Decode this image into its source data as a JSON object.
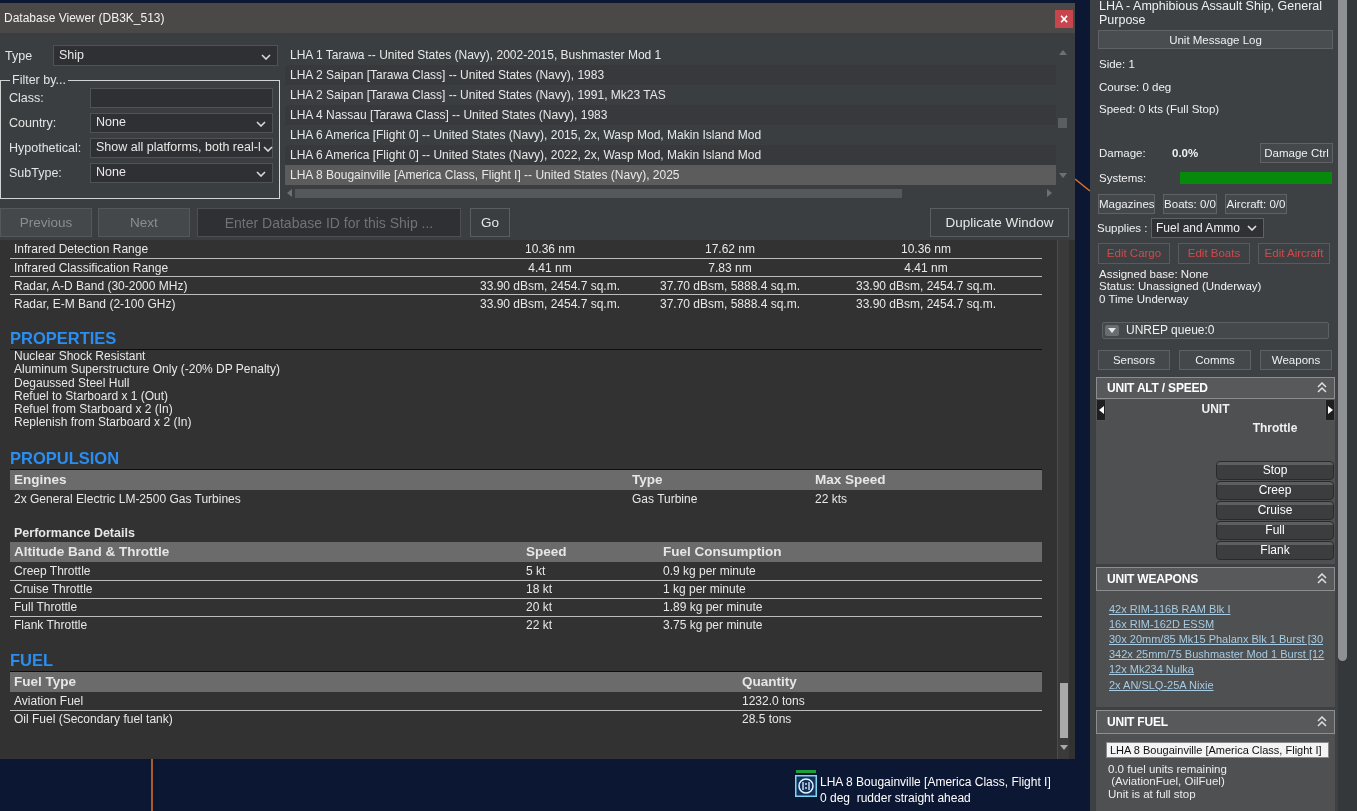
{
  "window": {
    "title": "Database Viewer (DB3K_513)",
    "close_label": "×"
  },
  "filters": {
    "type": {
      "label": "Type",
      "value": "Ship"
    },
    "legend": "Filter by...",
    "fields": [
      {
        "label": "Class:",
        "kind": "text"
      },
      {
        "label": "Country:",
        "kind": "select",
        "value": "None"
      },
      {
        "label": "Hypothetical:",
        "kind": "select",
        "value": "Show all platforms, both real-l"
      },
      {
        "label": "SubType:",
        "kind": "select",
        "value": "None"
      }
    ]
  },
  "results": {
    "items": [
      {
        "label": "LHA 1 Tarawa -- United States (Navy), 2002-2015, Bushmaster Mod 1",
        "selected": false
      },
      {
        "label": "LHA 2 Saipan [Tarawa Class] -- United States (Navy), 1983",
        "selected": false
      },
      {
        "label": "LHA 2 Saipan [Tarawa Class] -- United States (Navy), 1991, Mk23 TAS",
        "selected": false
      },
      {
        "label": "LHA 4 Nassau [Tarawa Class] -- United States (Navy), 1983",
        "selected": false
      },
      {
        "label": "LHA 6 America [Flight 0] -- United States (Navy), 2015, 2x, Wasp Mod, Makin Island Mod",
        "selected": false
      },
      {
        "label": "LHA 6 America [Flight 0] -- United States (Navy), 2022, 2x, Wasp Mod, Makin Island Mod",
        "selected": false
      },
      {
        "label": "LHA 8 Bougainville [America Class, Flight I] -- United States (Navy), 2025",
        "selected": true
      }
    ]
  },
  "navigation": {
    "buttons": [
      {
        "label": "Previous",
        "disabled": true
      },
      {
        "label": "Next",
        "disabled": true
      }
    ],
    "id_field": {
      "placeholder": "Enter Database ID for this Ship ..."
    },
    "go": "Go",
    "duplicate": "Duplicate Window"
  },
  "signatures": {
    "rows": [
      [
        "Infrared Detection Range",
        "10.36 nm",
        "17.62 nm",
        "10.36 nm"
      ],
      [
        "Infrared Classification Range",
        "4.41 nm",
        "7.83 nm",
        "4.41 nm"
      ],
      [
        "Radar, A-D Band (30-2000 MHz)",
        "33.90 dBsm, 2454.7 sq.m.",
        "37.70 dBsm, 5888.4 sq.m.",
        "33.90 dBsm, 2454.7 sq.m."
      ],
      [
        "Radar, E-M Band (2-100 GHz)",
        "33.90 dBsm, 2454.7 sq.m.",
        "37.70 dBsm, 5888.4 sq.m.",
        "33.90 dBsm, 2454.7 sq.m."
      ]
    ]
  },
  "properties": {
    "heading": "PROPERTIES",
    "items": [
      "Nuclear Shock Resistant",
      "Aluminum Superstructure Only (-20% DP Penalty)",
      "Degaussed Steel Hull",
      "Refuel to Starboard x 1 (Out)",
      "Refuel from Starboard x 2 (In)",
      "Replenish from Starboard x 2 (In)"
    ]
  },
  "propulsion": {
    "heading": "PROPULSION",
    "engines": {
      "columns": [
        "Engines",
        "Type",
        "Max Speed"
      ],
      "rows": [
        [
          "2x General Electric LM-2500 Gas Turbines",
          "Gas Turbine",
          "22 kts"
        ]
      ]
    },
    "performance": {
      "title": "Performance Details",
      "columns": [
        "Altitude Band & Throttle",
        "Speed",
        "Fuel Consumption"
      ],
      "rows": [
        [
          "Creep Throttle",
          "5 kt",
          "0.9 kg per minute"
        ],
        [
          "Cruise Throttle",
          "18 kt",
          "1 kg per minute"
        ],
        [
          "Full Throttle",
          "20 kt",
          "1.89 kg per minute"
        ],
        [
          "Flank Throttle",
          "22 kt",
          "3.75 kg per minute"
        ]
      ]
    }
  },
  "fuel": {
    "heading": "FUEL",
    "table": {
      "columns": [
        "Fuel Type",
        "Quantity"
      ],
      "rows": [
        [
          "Aviation Fuel",
          "1232.0 tons"
        ],
        [
          "Oil Fuel (Secondary fuel tank)",
          "28.5 tons"
        ]
      ]
    }
  },
  "map": {
    "unit_label": {
      "name": "LHA 8 Bougainville [America Class, Flight I]",
      "status": "0 deg  rudder straight ahead"
    }
  },
  "unit_panel": {
    "title": "LHA - Amphibious Assault Ship, General Purpose",
    "message_log": "Unit Message Log",
    "info": [
      "Side: 1",
      "Course: 0 deg",
      "Speed: 0 kts (Full Stop)"
    ],
    "damage": {
      "label": "Damage:",
      "value": "0.0%",
      "button": "Damage Ctrl"
    },
    "systems": {
      "label": "Systems:",
      "level": 1
    },
    "buttons": [
      "Magazines",
      "Boats: 0/0",
      "Aircraft: 0/0"
    ],
    "supplies": {
      "label": "Supplies :",
      "value": "Fuel and Ammo"
    },
    "edit_buttons": [
      "Edit Cargo",
      "Edit Boats",
      "Edit Aircraft"
    ],
    "status": [
      "Assigned base: None",
      "Status: Unassigned (Underway)",
      "0 Time Underway"
    ],
    "unrep": {
      "label": "UNREP queue:0",
      "expanded": false
    },
    "tabs": [
      "Sensors",
      "Comms",
      "Weapons"
    ],
    "sections": [
      {
        "kind": "throttle",
        "heading": "UNIT ALT / SPEED",
        "expanded": true,
        "unit_label": "UNIT",
        "throttle_label": "Throttle",
        "buttons": [
          "Stop",
          "Creep",
          "Cruise",
          "Full",
          "Flank"
        ]
      },
      {
        "kind": "weapons",
        "heading": "UNIT WEAPONS",
        "expanded": true,
        "items": [
          "42x RIM-116B RAM Blk I",
          "16x RIM-162D ESSM",
          "30x 20mm/85 Mk15 Phalanx Blk 1 Burst [30",
          "342x 25mm/75 Bushmaster Mod 1 Burst [12",
          "12x Mk234 Nulka",
          "2x AN/SLQ-25A Nixie"
        ]
      },
      {
        "kind": "fuel",
        "heading": "UNIT FUEL",
        "expanded": true,
        "unit_value": "LHA 8 Bougainville [America Class, Flight I]",
        "lines": [
          "0.0 fuel units remaining",
          " (AviationFuel, OilFuel)",
          "Unit is at full stop"
        ]
      }
    ]
  }
}
